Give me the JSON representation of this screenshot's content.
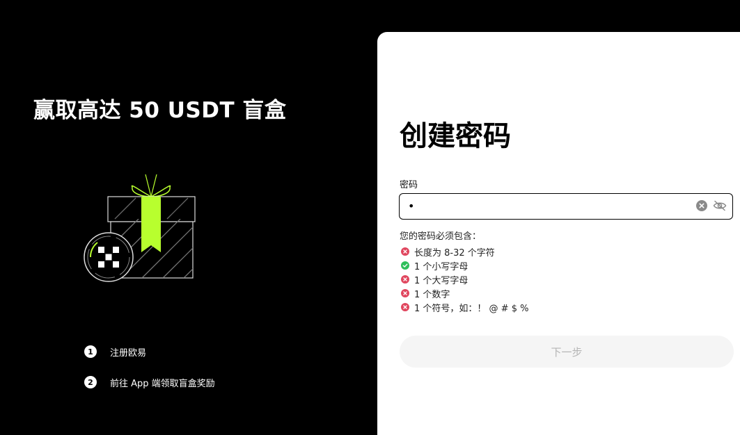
{
  "promo": {
    "title": "赢取高达 50 USDT 盲盒",
    "steps": [
      {
        "num": "1",
        "text": "注册欧易"
      },
      {
        "num": "2",
        "text": "前往 App 端领取盲盒奖励"
      }
    ]
  },
  "form": {
    "heading": "创建密码",
    "password_label": "密码",
    "password_value": "•",
    "requirements_title": "您的密码必须包含：",
    "requirements": [
      {
        "text": "长度为 8-32 个字符",
        "status": "unmet",
        "icon": "error-x-icon"
      },
      {
        "text": "1 个小写字母",
        "status": "met",
        "icon": "check-icon"
      },
      {
        "text": "1 个大写字母",
        "status": "unmet",
        "icon": "error-x-icon"
      },
      {
        "text": "1 个数字",
        "status": "unmet",
        "icon": "error-x-icon"
      },
      {
        "text": "1 个符号，如：！ @ # $ %",
        "status": "unmet",
        "icon": "error-x-icon"
      }
    ],
    "next_button": "下一步"
  },
  "colors": {
    "accent_green": "#b8ff2e",
    "error_red": "#e0465e",
    "success_green": "#2fbf5b",
    "disabled_button_bg": "#f5f5f5",
    "disabled_button_text": "#b5b5b5"
  }
}
